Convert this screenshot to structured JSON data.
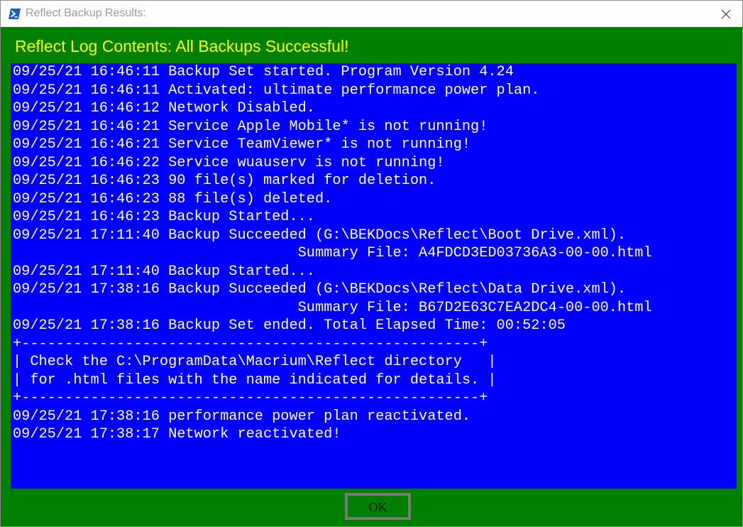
{
  "window": {
    "title": "Reflect Backup Results:",
    "icon": "powershell-icon",
    "close_icon": "close-icon"
  },
  "header": {
    "text": "Reflect Log Contents: All Backups Successful!"
  },
  "log": {
    "lines": [
      "09/25/21 16:46:11 Backup Set started. Program Version 4.24",
      "09/25/21 16:46:11 Activated: ultimate performance power plan.",
      "09/25/21 16:46:12 Network Disabled.",
      "09/25/21 16:46:21 Service Apple Mobile* is not running!",
      "09/25/21 16:46:21 Service TeamViewer* is not running!",
      "09/25/21 16:46:22 Service wuauserv is not running!",
      "09/25/21 16:46:23 90 file(s) marked for deletion.",
      "09/25/21 16:46:23 88 file(s) deleted.",
      "09/25/21 16:46:23 Backup Started...",
      "09/25/21 17:11:40 Backup Succeeded (G:\\BEKDocs\\Reflect\\Boot Drive.xml).",
      "                                 Summary File: A4FDCD3ED03736A3-00-00.html",
      "09/25/21 17:11:40 Backup Started...",
      "09/25/21 17:38:16 Backup Succeeded (G:\\BEKDocs\\Reflect\\Data Drive.xml).",
      "                                 Summary File: B67D2E63C7EA2DC4-00-00.html",
      "09/25/21 17:38:16 Backup Set ended. Total Elapsed Time: 00:52:05",
      "+-----------------------------------------------------+",
      "| Check the C:\\ProgramData\\Macrium\\Reflect directory   |",
      "| for .html files with the name indicated for details. |",
      "+-----------------------------------------------------+",
      "09/25/21 17:38:16 performance power plan reactivated.",
      "09/25/21 17:38:17 Network reactivated!"
    ]
  },
  "buttons": {
    "ok_label": "OK"
  },
  "colors": {
    "background": "#008000",
    "log_background": "#0000ff",
    "header_text": "#ffff00",
    "log_text": "#ffffff"
  }
}
